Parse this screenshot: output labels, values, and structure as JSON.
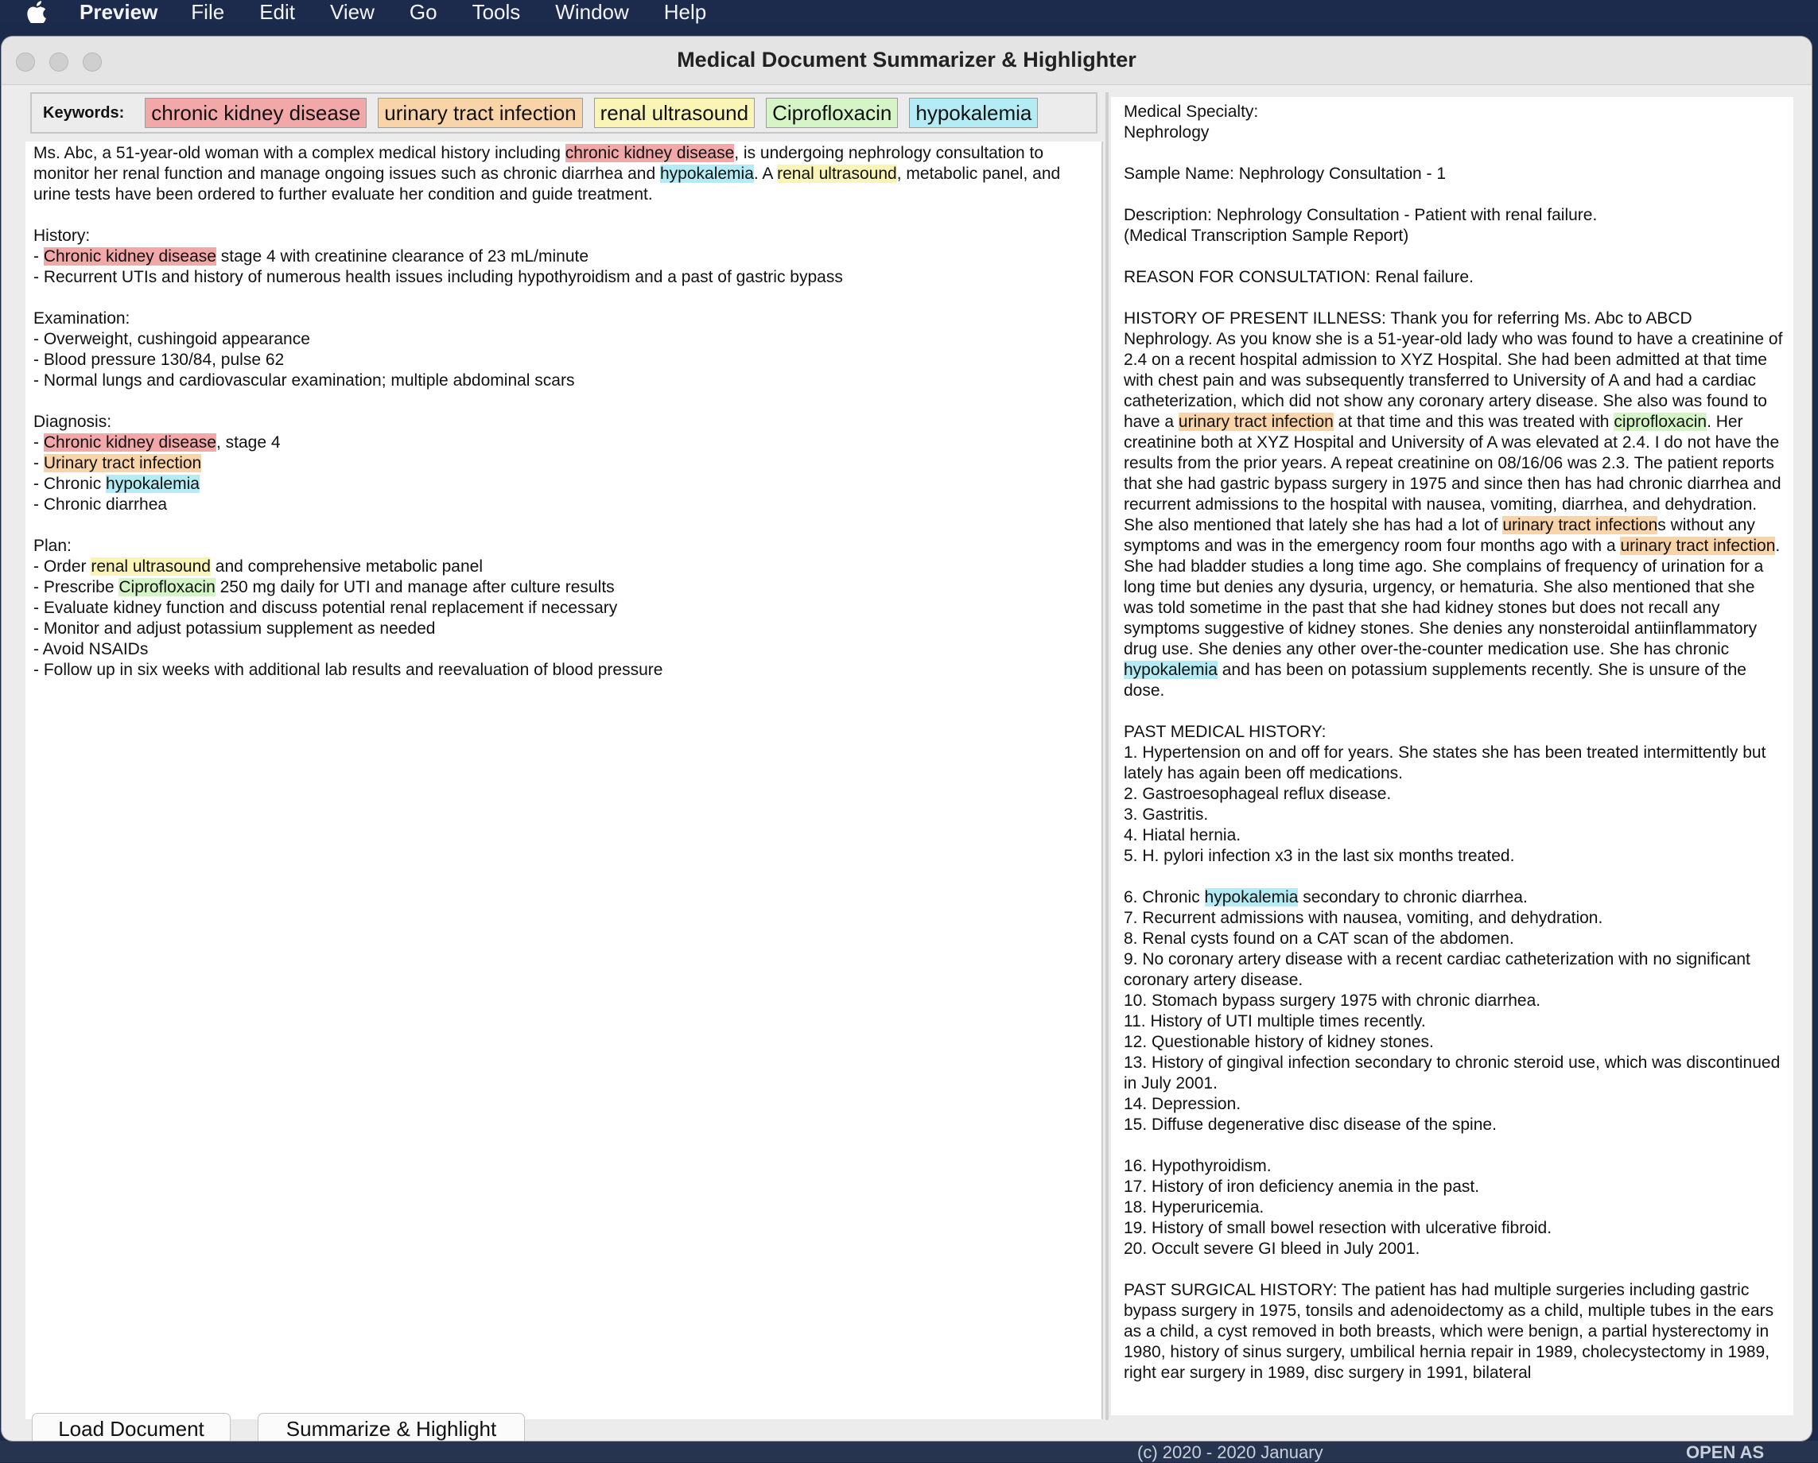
{
  "menubar": {
    "app": "Preview",
    "items": [
      "File",
      "Edit",
      "View",
      "Go",
      "Tools",
      "Window",
      "Help"
    ]
  },
  "window": {
    "title": "Medical Document Summarizer & Highlighter"
  },
  "keywords": {
    "label": "Keywords:",
    "chips": [
      {
        "text": "chronic kidney disease",
        "color": "#f2a8a8"
      },
      {
        "text": "urinary tract infection",
        "color": "#f8d4a8"
      },
      {
        "text": "renal ultrasound",
        "color": "#faf5b5"
      },
      {
        "text": "Ciprofloxacin",
        "color": "#d6f5c7"
      },
      {
        "text": "hypokalemia",
        "color": "#b3ecf5"
      }
    ]
  },
  "summary": {
    "intro": [
      {
        "t": "Ms. Abc, a 51-year-old woman with a complex medical history including "
      },
      {
        "t": "chronic kidney disease",
        "h": "ckd"
      },
      {
        "t": ", is undergoing nephrology consultation to monitor her renal function and manage ongoing issues such as chronic diarrhea and "
      },
      {
        "t": "hypokalemia",
        "h": "hypo"
      },
      {
        "t": ". A "
      },
      {
        "t": "renal ultrasound",
        "h": "renal"
      },
      {
        "t": ", metabolic panel, and urine tests have been ordered to further evaluate her condition and guide treatment."
      }
    ],
    "sections": [
      {
        "heading": "History:",
        "lines": [
          [
            {
              "t": "- "
            },
            {
              "t": "Chronic kidney disease",
              "h": "ckd"
            },
            {
              "t": " stage 4 with creatinine clearance of 23 mL/minute"
            }
          ],
          [
            {
              "t": "- Recurrent UTIs and history of numerous health issues including hypothyroidism and a past of gastric bypass"
            }
          ]
        ]
      },
      {
        "heading": "Examination:",
        "lines": [
          [
            {
              "t": "- Overweight, cushingoid appearance"
            }
          ],
          [
            {
              "t": "- Blood pressure 130/84, pulse 62"
            }
          ],
          [
            {
              "t": "- Normal lungs and cardiovascular examination; multiple abdominal scars"
            }
          ]
        ]
      },
      {
        "heading": "Diagnosis:",
        "lines": [
          [
            {
              "t": "- "
            },
            {
              "t": "Chronic kidney disease",
              "h": "ckd"
            },
            {
              "t": ", stage 4"
            }
          ],
          [
            {
              "t": "- "
            },
            {
              "t": "Urinary tract infection",
              "h": "uti"
            }
          ],
          [
            {
              "t": "- Chronic "
            },
            {
              "t": "hypokalemia",
              "h": "hypo"
            }
          ],
          [
            {
              "t": "- Chronic diarrhea"
            }
          ]
        ]
      },
      {
        "heading": "Plan:",
        "lines": [
          [
            {
              "t": "- Order "
            },
            {
              "t": "renal ultrasound",
              "h": "renal"
            },
            {
              "t": " and comprehensive metabolic panel"
            }
          ],
          [
            {
              "t": "- Prescribe "
            },
            {
              "t": "Ciprofloxacin",
              "h": "cipro"
            },
            {
              "t": " 250 mg daily for UTI and manage after culture results"
            }
          ],
          [
            {
              "t": "- Evaluate kidney function and discuss potential renal replacement if necessary"
            }
          ],
          [
            {
              "t": "- Monitor and adjust potassium supplement as needed"
            }
          ],
          [
            {
              "t": "- Avoid NSAIDs"
            }
          ],
          [
            {
              "t": "- Follow up in six weeks with additional lab results and reevaluation of blood pressure"
            }
          ]
        ]
      }
    ]
  },
  "document": {
    "paragraphs": [
      [
        [
          {
            "t": "Medical Specialty:"
          }
        ],
        [
          {
            "t": "Nephrology"
          }
        ]
      ],
      [
        [
          {
            "t": "Sample Name: Nephrology Consultation - 1"
          }
        ]
      ],
      [
        [
          {
            "t": "Description: Nephrology Consultation - Patient with renal failure."
          }
        ],
        [
          {
            "t": "(Medical Transcription Sample Report)"
          }
        ]
      ],
      [
        [
          {
            "t": "REASON FOR CONSULTATION: Renal failure."
          }
        ]
      ],
      [
        [
          {
            "t": "HISTORY OF PRESENT ILLNESS: Thank you for referring Ms. Abc to ABCD Nephrology. As you know she is a 51-year-old lady who was found to have a creatinine of 2.4 on a recent hospital admission to XYZ Hospital. She had been admitted at that time with chest pain and was subsequently transferred to University of A and had a cardiac catheterization, which did not show any coronary artery disease. She also was found to have a "
          },
          {
            "t": "urinary tract infection",
            "h": "uti"
          },
          {
            "t": " at that time and this was treated with "
          },
          {
            "t": "ciprofloxacin",
            "h": "cipro"
          },
          {
            "t": ". Her creatinine both at XYZ Hospital and University of A was elevated at 2.4. I do not have the results from the prior years. A repeat creatinine on 08/16/06 was 2.3. The patient reports that she had gastric bypass surgery in 1975 and since then has had chronic diarrhea and recurrent admissions to the hospital with nausea, vomiting, diarrhea, and dehydration. She also mentioned that lately she has had a lot of "
          },
          {
            "t": "urinary tract infection",
            "h": "uti"
          },
          {
            "t": "s without any symptoms and was in the emergency room four months ago with a "
          },
          {
            "t": "urinary tract infection",
            "h": "uti"
          },
          {
            "t": ". She had bladder studies a long time ago. She complains of frequency of urination for a long time but denies any dysuria, urgency, or hematuria. She also mentioned that she was told sometime in the past that she had kidney stones but does not recall any symptoms suggestive of kidney stones. She denies any nonsteroidal antiinflammatory drug use. She denies any other over-the-counter medication use. She has chronic "
          },
          {
            "t": "hypokalemia",
            "h": "hypo"
          },
          {
            "t": " and has been on potassium supplements recently. She is unsure of the dose."
          }
        ]
      ],
      [
        [
          {
            "t": "PAST MEDICAL HISTORY:"
          }
        ],
        [
          {
            "t": "1. Hypertension on and off for years. She states she has been treated intermittently but lately has again been off medications."
          }
        ],
        [
          {
            "t": "2. Gastroesophageal reflux disease."
          }
        ],
        [
          {
            "t": "3. Gastritis."
          }
        ],
        [
          {
            "t": "4. Hiatal hernia."
          }
        ],
        [
          {
            "t": "5. H. pylori infection x3 in the last six months treated."
          }
        ]
      ],
      [
        [
          {
            "t": "6. Chronic "
          },
          {
            "t": "hypokalemia",
            "h": "hypo"
          },
          {
            "t": " secondary to chronic diarrhea."
          }
        ],
        [
          {
            "t": "7. Recurrent admissions with nausea, vomiting, and dehydration."
          }
        ],
        [
          {
            "t": "8. Renal cysts found on a CAT scan of the abdomen."
          }
        ],
        [
          {
            "t": "9. No coronary artery disease with a recent cardiac catheterization with no significant coronary artery disease."
          }
        ],
        [
          {
            "t": "10. Stomach bypass surgery 1975 with chronic diarrhea."
          }
        ],
        [
          {
            "t": "11. History of UTI multiple times recently."
          }
        ],
        [
          {
            "t": "12. Questionable history of kidney stones."
          }
        ],
        [
          {
            "t": "13. History of gingival infection secondary to chronic steroid use, which was discontinued in July 2001."
          }
        ],
        [
          {
            "t": "14. Depression."
          }
        ],
        [
          {
            "t": "15. Diffuse degenerative disc disease of the spine."
          }
        ]
      ],
      [
        [
          {
            "t": "16. Hypothyroidism."
          }
        ],
        [
          {
            "t": "17. History of iron deficiency anemia in the past."
          }
        ],
        [
          {
            "t": "18. Hyperuricemia."
          }
        ],
        [
          {
            "t": "19. History of small bowel resection with ulcerative fibroid."
          }
        ],
        [
          {
            "t": "20. Occult severe GI bleed in July 2001."
          }
        ]
      ],
      [
        [
          {
            "t": "PAST SURGICAL HISTORY: The patient has had multiple surgeries including gastric bypass surgery in 1975, tonsils and adenoidectomy as a child, multiple tubes in the ears as a child, a cyst removed in both breasts, which were benign, a partial hysterectomy in 1980, history of sinus surgery, umbilical hernia repair in 1989, cholecystectomy in 1989, right ear surgery in 1989, disc surgery in 1991, bilateral"
          }
        ]
      ]
    ]
  },
  "buttons": {
    "load": "Load Document",
    "summarize": "Summarize & Highlight"
  },
  "desktop_peek": {
    "left_text": "(c) 2020 - 2020 January",
    "right_text": "OPEN AS"
  }
}
